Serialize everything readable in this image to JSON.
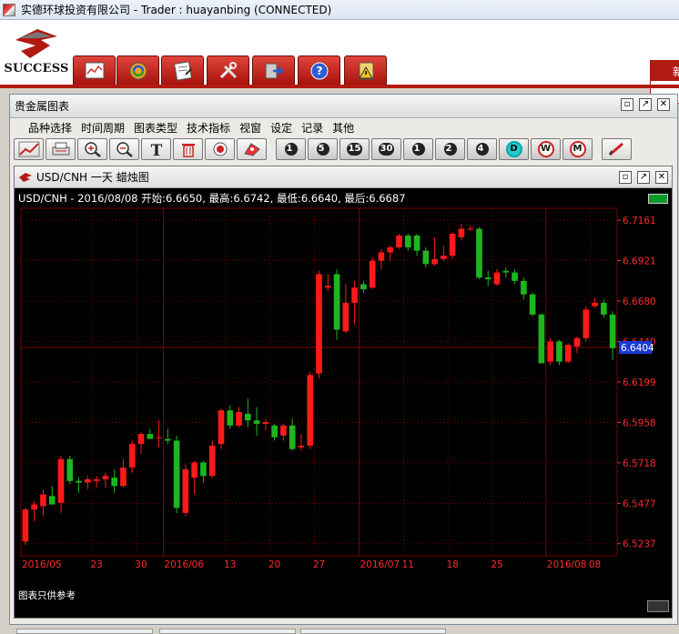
{
  "window": {
    "title": "实德环球投资有限公司 -  Trader : huayanbing (CONNECTED)"
  },
  "brand": {
    "name": "SUCCESS"
  },
  "right_tab": {
    "label": "新"
  },
  "outer": {
    "title": "贵金属图表",
    "menus": [
      "品种选择",
      "时间周期",
      "图表类型",
      "技术指标",
      "视窗",
      "设定",
      "记录",
      "其他"
    ],
    "period_buttons": [
      "1",
      "5",
      "15",
      "30",
      "1",
      "2",
      "4",
      "D",
      "W",
      "M"
    ]
  },
  "chart": {
    "window_title": "USD/CNH 一天 蜡烛图",
    "info": "USD/CNH - 2016/08/08 开始:6.6650, 最高:6.6742, 最低:6.6640, 最后:6.6687",
    "footnote": "图表只供参考",
    "colors": {
      "up": "#ff1a1a",
      "down": "#1fb521",
      "grid": "#7a0000",
      "axis_text": "#ff2a2a",
      "crosshair": "#7a0000",
      "current_bg": "#1a3ad8"
    }
  },
  "chart_data": {
    "type": "candlestick",
    "symbol": "USD/CNH",
    "period": "一天",
    "y_ticks": [
      "6.7161",
      "6.6921",
      "6.6680",
      "6.6440",
      "6.6199",
      "6.5958",
      "6.5718",
      "6.5477",
      "6.5237"
    ],
    "y_tick_values": [
      6.7161,
      6.6921,
      6.668,
      6.644,
      6.6199,
      6.5958,
      6.5718,
      6.5477,
      6.5237
    ],
    "ylim": [
      6.5165,
      6.7232
    ],
    "current_value": "6.6404",
    "x_ticks": [
      {
        "label": "2016/05",
        "index": 0
      },
      {
        "label": "23",
        "index": 8
      },
      {
        "label": "30",
        "index": 13
      },
      {
        "label": "2016/06",
        "index": 16
      },
      {
        "label": "13",
        "index": 23
      },
      {
        "label": "20",
        "index": 28
      },
      {
        "label": "27",
        "index": 33
      },
      {
        "label": "2016/07",
        "index": 38
      },
      {
        "label": "11",
        "index": 43
      },
      {
        "label": "18",
        "index": 48
      },
      {
        "label": "25",
        "index": 53
      },
      {
        "label": "2016/08",
        "index": 59
      },
      {
        "label": "08",
        "index": 64
      }
    ],
    "candles": [
      [
        6.525,
        6.545,
        6.523,
        6.544
      ],
      [
        6.544,
        6.549,
        6.537,
        6.547
      ],
      [
        6.546,
        6.556,
        6.54,
        6.553
      ],
      [
        6.552,
        6.547,
        6.558,
        6.547
      ],
      [
        6.548,
        6.576,
        6.542,
        6.574
      ],
      [
        6.574,
        6.576,
        6.559,
        6.561
      ],
      [
        6.561,
        6.563,
        6.554,
        6.56
      ],
      [
        6.56,
        6.564,
        6.556,
        6.562
      ],
      [
        6.561,
        6.564,
        6.557,
        6.562
      ],
      [
        6.562,
        6.566,
        6.557,
        6.564
      ],
      [
        6.563,
        6.568,
        6.554,
        6.558
      ],
      [
        6.558,
        6.574,
        6.557,
        6.569
      ],
      [
        6.569,
        6.585,
        6.566,
        6.583
      ],
      [
        6.583,
        6.59,
        6.577,
        6.589
      ],
      [
        6.589,
        6.592,
        6.586,
        6.586
      ],
      [
        6.587,
        6.597,
        6.581,
        6.587
      ],
      [
        6.586,
        6.592,
        6.583,
        6.585
      ],
      [
        6.585,
        6.588,
        6.542,
        6.545
      ],
      [
        6.542,
        6.571,
        6.54,
        6.568
      ],
      [
        6.563,
        6.573,
        6.553,
        6.572
      ],
      [
        6.572,
        6.573,
        6.56,
        6.564
      ],
      [
        6.564,
        6.585,
        6.563,
        6.582
      ],
      [
        6.583,
        6.604,
        6.58,
        6.603
      ],
      [
        6.603,
        6.606,
        6.592,
        6.594
      ],
      [
        6.594,
        6.605,
        6.593,
        6.602
      ],
      [
        6.601,
        6.61,
        6.593,
        6.597
      ],
      [
        6.597,
        6.605,
        6.588,
        6.595
      ],
      [
        6.595,
        6.598,
        6.591,
        6.596
      ],
      [
        6.594,
        6.595,
        6.585,
        6.587
      ],
      [
        6.588,
        6.595,
        6.585,
        6.594
      ],
      [
        6.594,
        6.598,
        6.579,
        6.58
      ],
      [
        6.581,
        6.589,
        6.579,
        6.582
      ],
      [
        6.582,
        6.626,
        6.58,
        6.624
      ],
      [
        6.625,
        6.686,
        6.622,
        6.684
      ],
      [
        6.676,
        6.684,
        6.674,
        6.677
      ],
      [
        6.684,
        6.687,
        6.645,
        6.651
      ],
      [
        6.65,
        6.678,
        6.649,
        6.667
      ],
      [
        6.667,
        6.68,
        6.654,
        6.676
      ],
      [
        6.678,
        6.68,
        6.673,
        6.675
      ],
      [
        6.676,
        6.694,
        6.675,
        6.692
      ],
      [
        6.692,
        6.699,
        6.687,
        6.697
      ],
      [
        6.697,
        6.701,
        6.692,
        6.7
      ],
      [
        6.7,
        6.708,
        6.699,
        6.707
      ],
      [
        6.707,
        6.708,
        6.698,
        6.7
      ],
      [
        6.707,
        6.708,
        6.695,
        6.698
      ],
      [
        6.698,
        6.7,
        6.688,
        6.69
      ],
      [
        6.69,
        6.706,
        6.689,
        6.693
      ],
      [
        6.693,
        6.701,
        6.692,
        6.695
      ],
      [
        6.695,
        6.709,
        6.693,
        6.708
      ],
      [
        6.706,
        6.714,
        6.704,
        6.711
      ],
      [
        6.711,
        6.713,
        6.71,
        6.711
      ],
      [
        6.711,
        6.712,
        6.681,
        6.682
      ],
      [
        6.682,
        6.686,
        6.677,
        6.681
      ],
      [
        6.678,
        6.687,
        6.677,
        6.685
      ],
      [
        6.686,
        6.688,
        6.682,
        6.685
      ],
      [
        6.685,
        6.687,
        6.678,
        6.68
      ],
      [
        6.68,
        6.682,
        6.669,
        6.672
      ],
      [
        6.672,
        6.673,
        6.659,
        6.66
      ],
      [
        6.66,
        6.661,
        6.634,
        6.631
      ],
      [
        6.632,
        6.646,
        6.63,
        6.644
      ],
      [
        6.644,
        6.645,
        6.63,
        6.632
      ],
      [
        6.632,
        6.643,
        6.631,
        6.642
      ],
      [
        6.641,
        6.647,
        6.637,
        6.646
      ],
      [
        6.646,
        6.665,
        6.644,
        6.663
      ],
      [
        6.665,
        6.67,
        6.664,
        6.667
      ],
      [
        6.667,
        6.669,
        6.658,
        6.66
      ],
      [
        6.66,
        6.662,
        6.633,
        6.64
      ]
    ]
  }
}
